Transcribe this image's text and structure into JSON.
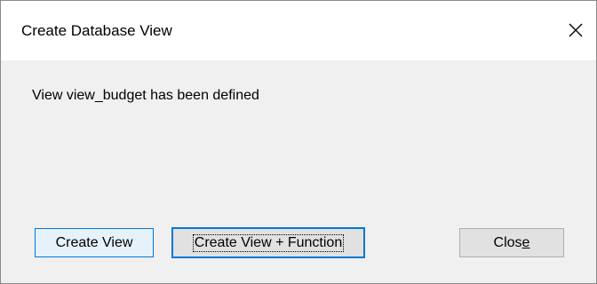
{
  "window": {
    "title": "Create Database View",
    "close_glyph": "✕"
  },
  "dialog": {
    "message": "View view_budget has been defined"
  },
  "buttons": {
    "create_view": "Create View",
    "create_view_function": "Create View + Function",
    "close_prefix": "Clos",
    "close_mnemonic": "e"
  },
  "icons": {
    "close": "close-icon"
  },
  "colors": {
    "accent": "#0078d7",
    "button_face": "#e1e1e1",
    "dialog_bg": "#f0f0f0",
    "title_bg": "#ffffff"
  }
}
